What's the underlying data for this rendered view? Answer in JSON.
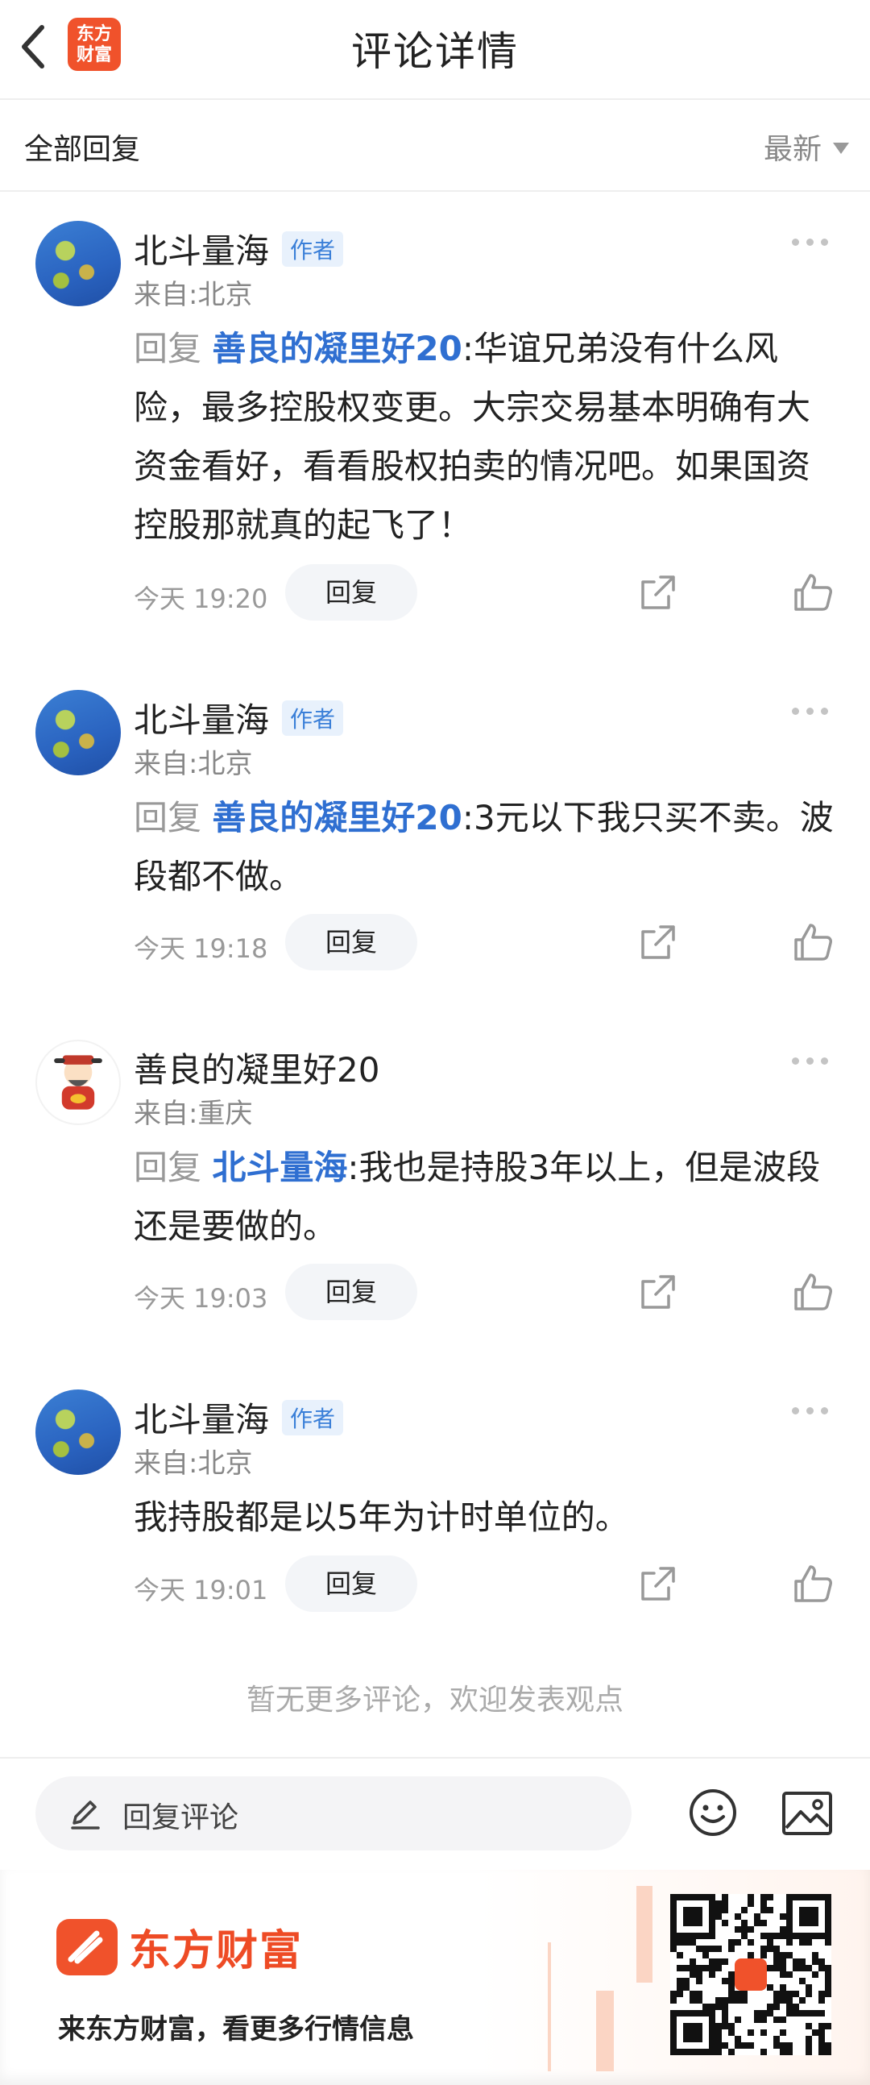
{
  "header": {
    "title": "评论详情",
    "logo_text_1": "东方",
    "logo_text_2": "财富"
  },
  "subheader": {
    "left": "全部回复",
    "sort": "最新"
  },
  "comments": [
    {
      "name": "北斗量海",
      "tag": "作者",
      "loc": "来自:北京",
      "reply_prefix": "回复",
      "reply_to": "善良的凝里好20",
      "text": ":华谊兄弟没有什么风险，最多控股权变更。大宗交易基本明确有大资金看好，看看股权拍卖的情况吧。如果国资控股那就真的起飞了！",
      "time": "今天 19:20",
      "reply_btn": "回复"
    },
    {
      "name": "北斗量海",
      "tag": "作者",
      "loc": "来自:北京",
      "reply_prefix": "回复",
      "reply_to": "善良的凝里好20",
      "text": ":3元以下我只买不卖。波段都不做。",
      "time": "今天 19:18",
      "reply_btn": "回复"
    },
    {
      "name": "善良的凝里好20",
      "loc": "来自:重庆",
      "reply_prefix": "回复",
      "reply_to": "北斗量海",
      "text": ":我也是持股3年以上，但是波段还是要做的。",
      "time": "今天 19:03",
      "reply_btn": "回复"
    },
    {
      "name": "北斗量海",
      "tag": "作者",
      "loc": "来自:北京",
      "text": "我持股都是以5年为计时单位的。",
      "time": "今天 19:01",
      "reply_btn": "回复"
    }
  ],
  "footer": {
    "no_more": "暂无更多评论，欢迎发表观点"
  },
  "input": {
    "placeholder": "回复评论"
  },
  "promo": {
    "brand": "东方财富",
    "slogan": "来东方财富，看更多行情信息"
  },
  "colors": {
    "brand": "#f0522b",
    "link": "#2f6fd1",
    "tag_bg": "#e8f1fc"
  },
  "icons": [
    "back-icon",
    "more-icon",
    "share-icon",
    "like-icon",
    "pen-icon",
    "emoji-icon",
    "image-icon",
    "qr-code"
  ]
}
